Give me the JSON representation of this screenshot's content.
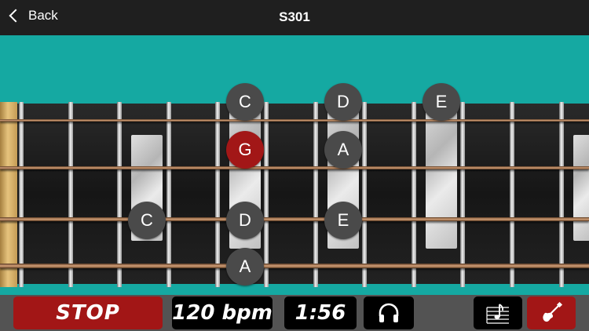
{
  "header": {
    "back_label": "Back",
    "title": "S301"
  },
  "fretboard": {
    "notes": [
      "C",
      "D",
      "E",
      "G",
      "A",
      "C",
      "D",
      "E",
      "A"
    ]
  },
  "controls": {
    "stop_label": "STOP",
    "tempo_label": "120 bpm",
    "time_label": "1:56"
  },
  "colors": {
    "teal": "#15a9a2",
    "accent_red": "#a21616",
    "note_gray": "#4a4a4a"
  },
  "icons": {
    "headphones": "headphones-icon",
    "score": "sheet-music-icon",
    "instrument": "guitar-icon",
    "back": "chevron-left-icon"
  }
}
